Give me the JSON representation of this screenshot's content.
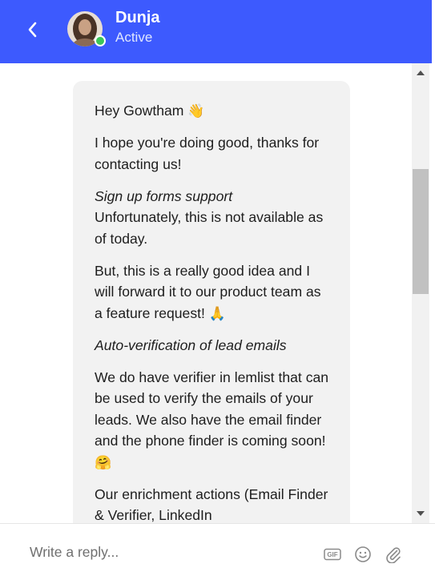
{
  "header": {
    "agent_name": "Dunja",
    "agent_status": "Active",
    "background_color": "#3d5afe",
    "back_icon": "chevron-left-icon",
    "presence_color": "#3bc65a"
  },
  "message": {
    "greeting": "Hey Gowtham",
    "greeting_emoji": "👋",
    "intro": "I hope you're doing good, thanks for contacting us!",
    "section1_title": "Sign up forms support",
    "section1_body": "Unfortunately, this is not available as of today.",
    "section1_followup": "But, this is a really good idea and I will forward it to our product team as a feature request!",
    "section1_emoji": "🙏",
    "section2_title": "Auto-verification of lead emails",
    "section2_body": "We do have verifier in lemlist that can be used to verify the emails of your leads. We also have the email finder and the phone finder is coming soon!",
    "section2_emoji": "🤗",
    "section3_partial": "Our enrichment actions (Email Finder & Verifier, LinkedIn"
  },
  "composer": {
    "placeholder": "Write a reply...",
    "value": "",
    "gif_label": "GIF",
    "emoji_icon": "smiley-icon",
    "attach_icon": "paperclip-icon"
  }
}
